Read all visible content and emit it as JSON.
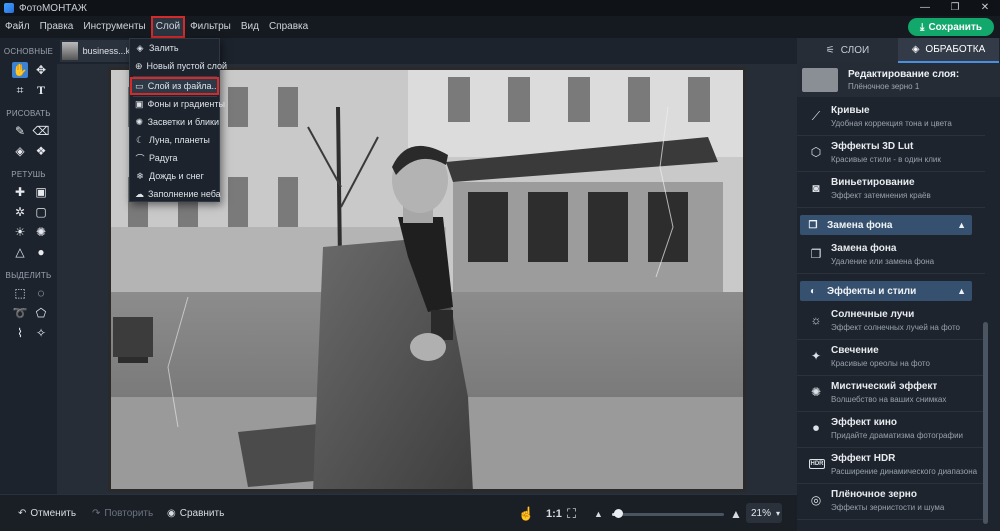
{
  "app": {
    "title": "ФотоМОНТАЖ"
  },
  "window_controls": [
    "—",
    "❐",
    "✕"
  ],
  "menu": [
    "Файл",
    "Правка",
    "Инструменты",
    "Слой",
    "Фильтры",
    "Вид",
    "Справка"
  ],
  "save_button": "Сохранить",
  "left_toolbar": {
    "sections": [
      "ОСНОВНЫЕ",
      "РИСОВАТЬ",
      "РЕТУШЬ",
      "ВЫДЕЛИТЬ"
    ]
  },
  "document_tab": {
    "name": "business...kin"
  },
  "layer_menu": {
    "items": [
      {
        "icon": "fill-icon",
        "label": "Залить"
      },
      {
        "icon": "plus-circle-icon",
        "label": "Новый пустой слой"
      },
      {
        "icon": "folder-icon",
        "label": "Слой из файла..."
      },
      {
        "icon": "image-icon",
        "label": "Фоны и градиенты"
      },
      {
        "icon": "sparkle-icon",
        "label": "Засветки и блики"
      },
      {
        "icon": "moon-icon",
        "label": "Луна, планеты"
      },
      {
        "icon": "rainbow-icon",
        "label": "Радуга"
      },
      {
        "icon": "snowflake-icon",
        "label": "Дождь и снег"
      },
      {
        "icon": "cloud-icon",
        "label": "Заполнение неба"
      }
    ]
  },
  "bottom_bar": {
    "undo": "Отменить",
    "redo": "Повторить",
    "compare": "Сравнить",
    "one_to_one": "1:1",
    "zoom": "21%",
    "zoom_fraction": 0.21
  },
  "right_panel": {
    "tabs": [
      "СЛОИ",
      "ОБРАБОТКА"
    ],
    "editing_title": "Редактирование слоя:",
    "editing_subtitle": "Плёночное зерно 1",
    "items": [
      {
        "name": "Кривые",
        "desc": "Удобная коррекция тона и цвета"
      },
      {
        "name": "Эффекты 3D Lut",
        "desc": "Красивые стили - в один клик"
      },
      {
        "name": "Виньетирование",
        "desc": "Эффект затемнения краёв"
      },
      {
        "name": "Замена фона",
        "desc": "Удаление или замена фона"
      },
      {
        "name": "Солнечные лучи",
        "desc": "Эффект солнечных лучей на фото"
      },
      {
        "name": "Свечение",
        "desc": "Красивые ореолы на фото"
      },
      {
        "name": "Мистический эффект",
        "desc": "Волшебство на ваших снимках"
      },
      {
        "name": "Эффект кино",
        "desc": "Придайте драматизма фотографии"
      },
      {
        "name": "Эффект HDR",
        "desc": "Расширение динамического диапазона"
      },
      {
        "name": "Плёночное зерно",
        "desc": "Эффекты зернистости и шума"
      }
    ],
    "sections": [
      "Замена фона",
      "Эффекты и стили"
    ]
  },
  "colors": {
    "accent": "#3b82d0",
    "save": "#13a86b",
    "highlight": "#d42a2a",
    "section": "#36506f"
  }
}
